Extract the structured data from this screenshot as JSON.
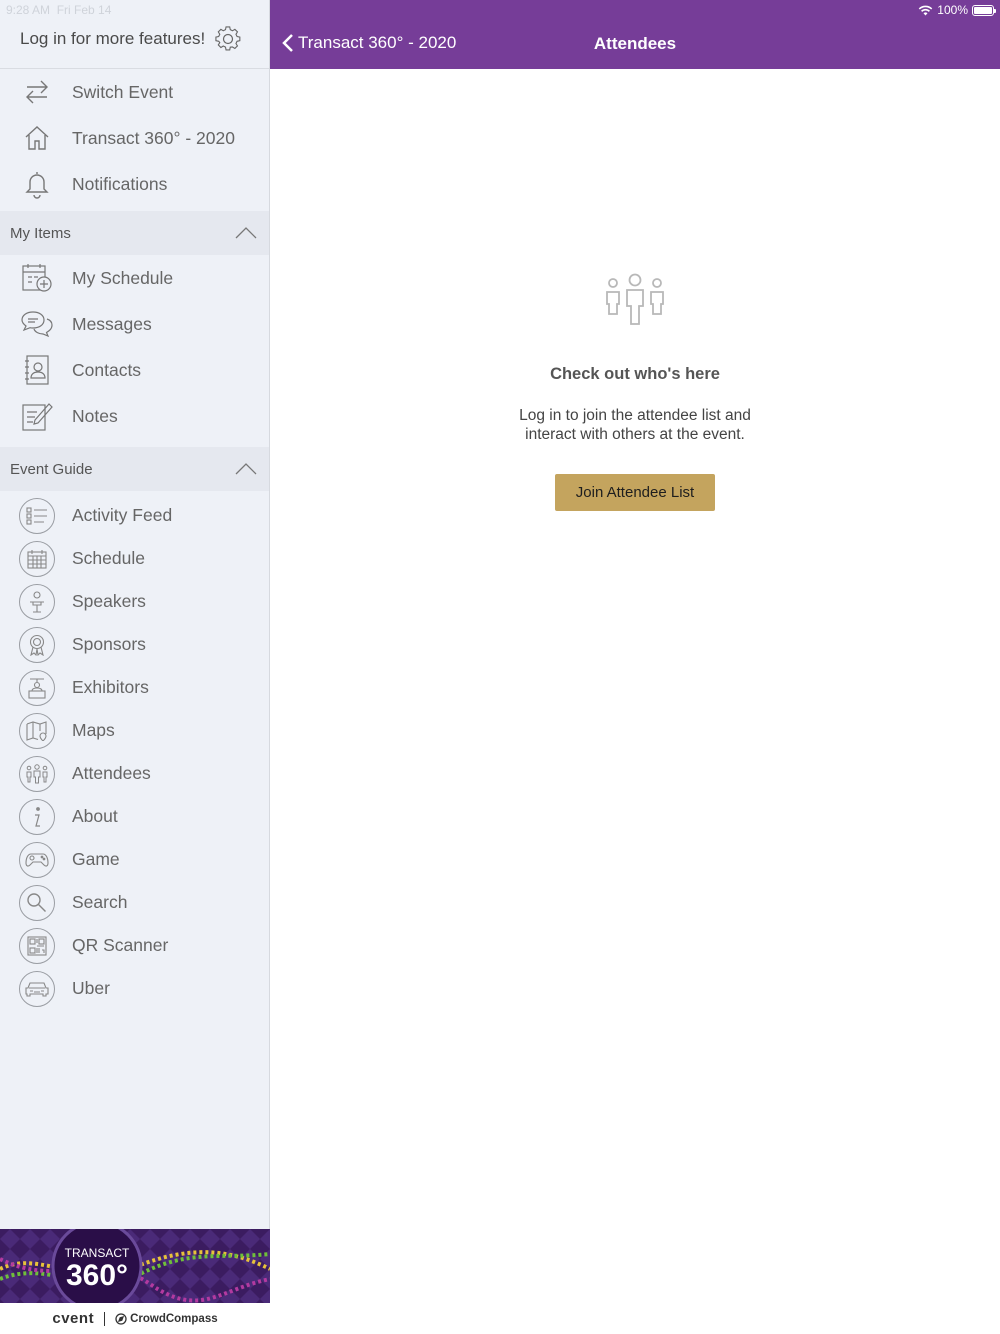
{
  "status": {
    "time": "9:28 AM",
    "date": "Fri Feb 14",
    "battery": "100%"
  },
  "sidebar": {
    "login_text": "Log in for more features!",
    "top_items": [
      {
        "label": "Switch Event",
        "icon": "switch-arrows-icon"
      },
      {
        "label": "Transact 360° - 2020",
        "icon": "home-icon"
      },
      {
        "label": "Notifications",
        "icon": "bell-icon"
      }
    ],
    "my_items": {
      "title": "My Items",
      "items": [
        {
          "label": "My Schedule",
          "icon": "calendar-add-icon"
        },
        {
          "label": "Messages",
          "icon": "chat-bubbles-icon"
        },
        {
          "label": "Contacts",
          "icon": "contact-book-icon"
        },
        {
          "label": "Notes",
          "icon": "notepad-pencil-icon"
        }
      ]
    },
    "event_guide": {
      "title": "Event Guide",
      "items": [
        {
          "label": "Activity Feed",
          "icon": "list-icon"
        },
        {
          "label": "Schedule",
          "icon": "calendar-icon"
        },
        {
          "label": "Speakers",
          "icon": "podium-speaker-icon"
        },
        {
          "label": "Sponsors",
          "icon": "ribbon-award-icon"
        },
        {
          "label": "Exhibitors",
          "icon": "booth-icon"
        },
        {
          "label": "Maps",
          "icon": "map-pin-icon"
        },
        {
          "label": "Attendees",
          "icon": "people-icon"
        },
        {
          "label": "About",
          "icon": "info-icon"
        },
        {
          "label": "Game",
          "icon": "gamepad-icon"
        },
        {
          "label": "Search",
          "icon": "magnifier-icon"
        },
        {
          "label": "QR Scanner",
          "icon": "qr-code-icon"
        },
        {
          "label": "Uber",
          "icon": "car-icon"
        }
      ]
    },
    "banner": {
      "line1": "TRANSACT",
      "line2": "360°"
    },
    "footer": {
      "brand1": "cvent",
      "brand2": "CrowdCompass"
    }
  },
  "header": {
    "back_label": "Transact 360° - 2020",
    "title": "Attendees"
  },
  "main": {
    "empty_title": "Check out who's here",
    "empty_text_line1": "Log in to join the attendee list and",
    "empty_text_line2": "interact with others at the event.",
    "join_button": "Join Attendee List"
  },
  "colors": {
    "header_bg": "#763d98",
    "button_bg": "#c4a45e",
    "sidebar_bg": "#eef1f7"
  }
}
